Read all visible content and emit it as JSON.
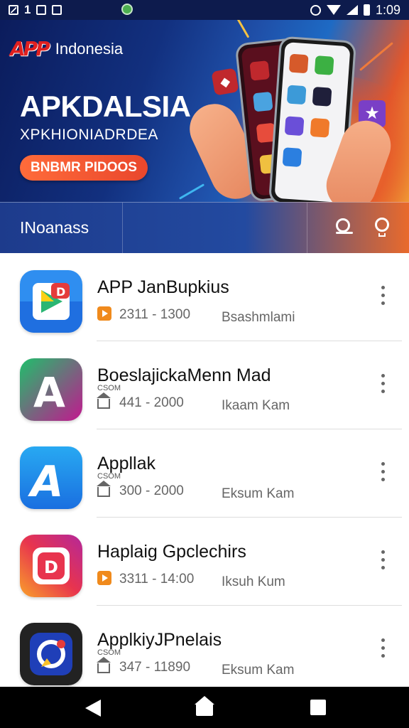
{
  "status_bar": {
    "left_number": "1",
    "time": "1:09"
  },
  "header": {
    "logo_mark": "APP",
    "brand": "Indonesia"
  },
  "hero": {
    "title": "APKDALSIA",
    "subtitle": "XPKHIONIADRDEA",
    "button_label": "BNBMR PIDOOS"
  },
  "search_strip": {
    "label": "INoanass"
  },
  "apps": [
    {
      "name": "APP JanBupkius",
      "small_label": "",
      "meta_icon": "play-icon",
      "range": "2311 - 1300",
      "developer": "Bsashmlami",
      "icon_colors": [
        "#2f8ef0",
        "#1565d8"
      ]
    },
    {
      "name": "BoeslajickaMenn Mad",
      "small_label": "CSOM",
      "meta_icon": "home-icon",
      "range": "441 - 2000",
      "developer": "Ikaam Kam",
      "icon_colors": [
        "#1fbf6b",
        "#c2188f"
      ]
    },
    {
      "name": "Appllak",
      "small_label": "CSOM",
      "meta_icon": "home-icon",
      "range": "300 - 2000",
      "developer": "Eksum Kam",
      "icon_colors": [
        "#28a9f2",
        "#1a6fe0"
      ]
    },
    {
      "name": "Haplaig Gpclechirs",
      "small_label": "",
      "meta_icon": "play-icon",
      "range": "3311 - 14:00",
      "developer": "Iksuh Kum",
      "icon_colors": [
        "#f9a12a",
        "#d02a7a"
      ]
    },
    {
      "name": "ApplkiyJPnelais",
      "small_label": "CSOM",
      "meta_icon": "home-icon",
      "range": "347 - 11890",
      "developer": "Eksum Kam",
      "icon_colors": [
        "#2a2a2a",
        "#111111"
      ]
    }
  ]
}
